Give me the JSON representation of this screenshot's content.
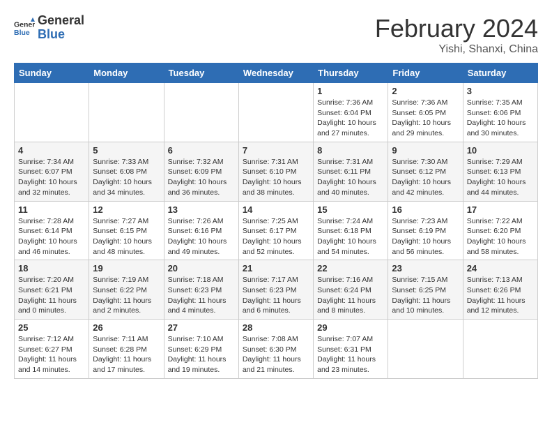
{
  "header": {
    "logo_general": "General",
    "logo_blue": "Blue",
    "title": "February 2024",
    "subtitle": "Yishi, Shanxi, China"
  },
  "weekdays": [
    "Sunday",
    "Monday",
    "Tuesday",
    "Wednesday",
    "Thursday",
    "Friday",
    "Saturday"
  ],
  "weeks": [
    [
      {
        "day": "",
        "info": ""
      },
      {
        "day": "",
        "info": ""
      },
      {
        "day": "",
        "info": ""
      },
      {
        "day": "",
        "info": ""
      },
      {
        "day": "1",
        "info": "Sunrise: 7:36 AM\nSunset: 6:04 PM\nDaylight: 10 hours and 27 minutes."
      },
      {
        "day": "2",
        "info": "Sunrise: 7:36 AM\nSunset: 6:05 PM\nDaylight: 10 hours and 29 minutes."
      },
      {
        "day": "3",
        "info": "Sunrise: 7:35 AM\nSunset: 6:06 PM\nDaylight: 10 hours and 30 minutes."
      }
    ],
    [
      {
        "day": "4",
        "info": "Sunrise: 7:34 AM\nSunset: 6:07 PM\nDaylight: 10 hours and 32 minutes."
      },
      {
        "day": "5",
        "info": "Sunrise: 7:33 AM\nSunset: 6:08 PM\nDaylight: 10 hours and 34 minutes."
      },
      {
        "day": "6",
        "info": "Sunrise: 7:32 AM\nSunset: 6:09 PM\nDaylight: 10 hours and 36 minutes."
      },
      {
        "day": "7",
        "info": "Sunrise: 7:31 AM\nSunset: 6:10 PM\nDaylight: 10 hours and 38 minutes."
      },
      {
        "day": "8",
        "info": "Sunrise: 7:31 AM\nSunset: 6:11 PM\nDaylight: 10 hours and 40 minutes."
      },
      {
        "day": "9",
        "info": "Sunrise: 7:30 AM\nSunset: 6:12 PM\nDaylight: 10 hours and 42 minutes."
      },
      {
        "day": "10",
        "info": "Sunrise: 7:29 AM\nSunset: 6:13 PM\nDaylight: 10 hours and 44 minutes."
      }
    ],
    [
      {
        "day": "11",
        "info": "Sunrise: 7:28 AM\nSunset: 6:14 PM\nDaylight: 10 hours and 46 minutes."
      },
      {
        "day": "12",
        "info": "Sunrise: 7:27 AM\nSunset: 6:15 PM\nDaylight: 10 hours and 48 minutes."
      },
      {
        "day": "13",
        "info": "Sunrise: 7:26 AM\nSunset: 6:16 PM\nDaylight: 10 hours and 49 minutes."
      },
      {
        "day": "14",
        "info": "Sunrise: 7:25 AM\nSunset: 6:17 PM\nDaylight: 10 hours and 52 minutes."
      },
      {
        "day": "15",
        "info": "Sunrise: 7:24 AM\nSunset: 6:18 PM\nDaylight: 10 hours and 54 minutes."
      },
      {
        "day": "16",
        "info": "Sunrise: 7:23 AM\nSunset: 6:19 PM\nDaylight: 10 hours and 56 minutes."
      },
      {
        "day": "17",
        "info": "Sunrise: 7:22 AM\nSunset: 6:20 PM\nDaylight: 10 hours and 58 minutes."
      }
    ],
    [
      {
        "day": "18",
        "info": "Sunrise: 7:20 AM\nSunset: 6:21 PM\nDaylight: 11 hours and 0 minutes."
      },
      {
        "day": "19",
        "info": "Sunrise: 7:19 AM\nSunset: 6:22 PM\nDaylight: 11 hours and 2 minutes."
      },
      {
        "day": "20",
        "info": "Sunrise: 7:18 AM\nSunset: 6:23 PM\nDaylight: 11 hours and 4 minutes."
      },
      {
        "day": "21",
        "info": "Sunrise: 7:17 AM\nSunset: 6:23 PM\nDaylight: 11 hours and 6 minutes."
      },
      {
        "day": "22",
        "info": "Sunrise: 7:16 AM\nSunset: 6:24 PM\nDaylight: 11 hours and 8 minutes."
      },
      {
        "day": "23",
        "info": "Sunrise: 7:15 AM\nSunset: 6:25 PM\nDaylight: 11 hours and 10 minutes."
      },
      {
        "day": "24",
        "info": "Sunrise: 7:13 AM\nSunset: 6:26 PM\nDaylight: 11 hours and 12 minutes."
      }
    ],
    [
      {
        "day": "25",
        "info": "Sunrise: 7:12 AM\nSunset: 6:27 PM\nDaylight: 11 hours and 14 minutes."
      },
      {
        "day": "26",
        "info": "Sunrise: 7:11 AM\nSunset: 6:28 PM\nDaylight: 11 hours and 17 minutes."
      },
      {
        "day": "27",
        "info": "Sunrise: 7:10 AM\nSunset: 6:29 PM\nDaylight: 11 hours and 19 minutes."
      },
      {
        "day": "28",
        "info": "Sunrise: 7:08 AM\nSunset: 6:30 PM\nDaylight: 11 hours and 21 minutes."
      },
      {
        "day": "29",
        "info": "Sunrise: 7:07 AM\nSunset: 6:31 PM\nDaylight: 11 hours and 23 minutes."
      },
      {
        "day": "",
        "info": ""
      },
      {
        "day": "",
        "info": ""
      }
    ]
  ]
}
